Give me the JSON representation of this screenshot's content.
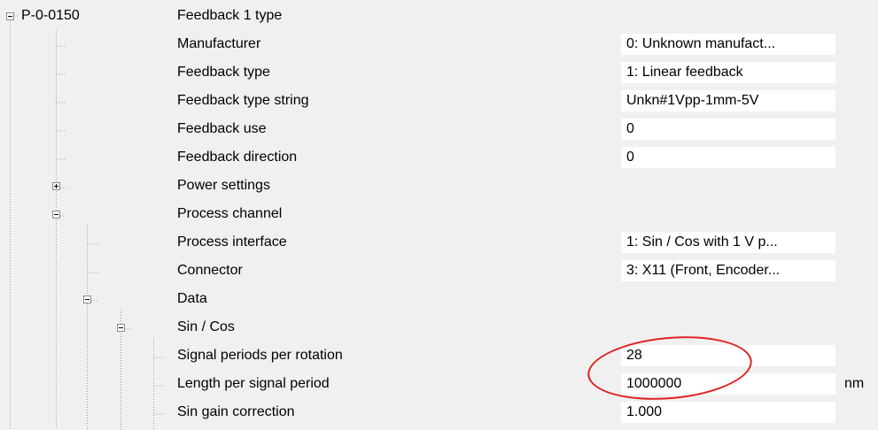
{
  "tree": {
    "root": {
      "id": "P-0-0150",
      "label": "Feedback 1 type"
    },
    "items": [
      {
        "label": "Manufacturer",
        "value": "0: Unknown manufact..."
      },
      {
        "label": "Feedback type",
        "value": "1: Linear feedback"
      },
      {
        "label": "Feedback type string",
        "value": "Unkn#1Vpp-1mm-5V"
      },
      {
        "label": "Feedback use",
        "value": "0"
      },
      {
        "label": "Feedback direction",
        "value": "0"
      },
      {
        "label": "Power settings",
        "value": ""
      },
      {
        "label": "Process channel",
        "value": ""
      },
      {
        "label": "Process interface",
        "value": "1: Sin / Cos with 1 V p..."
      },
      {
        "label": "Connector",
        "value": "3: X11 (Front, Encoder..."
      },
      {
        "label": "Data",
        "value": ""
      },
      {
        "label": "Sin / Cos",
        "value": ""
      },
      {
        "label": "Signal periods per rotation",
        "value": "28"
      },
      {
        "label": "Length per signal period",
        "value": "1000000",
        "unit": "nm"
      },
      {
        "label": "Sin gain correction",
        "value": "1.000"
      }
    ]
  },
  "colors": {
    "highlight": "#e02020",
    "background": "#f0f0f0",
    "field": "#ffffff"
  },
  "icons": [
    "minus-box-icon",
    "plus-box-icon"
  ]
}
